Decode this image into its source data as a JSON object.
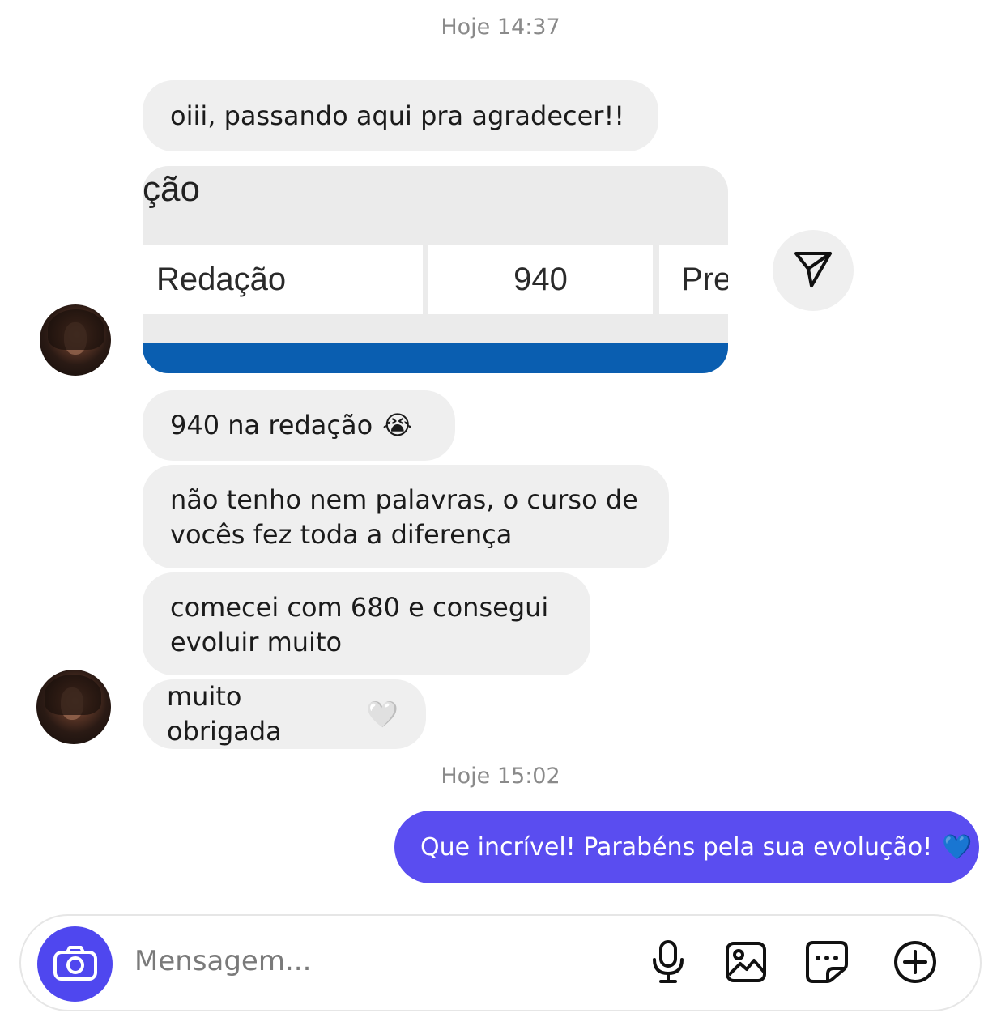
{
  "timestamps": [
    "Hoje 14:37",
    "Hoje 15:02"
  ],
  "received_messages": [
    "oiii, passando aqui pra agradecer!!",
    "940 na redação",
    "não tenho nem palavras, o curso de",
    "vocês fez toda a diferença",
    "comecei com 680 e consegui",
    "evoluir muito",
    "muito obrigada"
  ],
  "emojis": {
    "crying": "😭",
    "white_heart": "🤍",
    "blue_heart": "💙"
  },
  "screenshot_card": {
    "title_fragment": "ção",
    "cells": [
      "Redação",
      "940",
      "Pre"
    ],
    "bar_color": "#0a5eb0"
  },
  "sent_message": "Que incrível! Parabéns pela sua evolução!",
  "composer": {
    "placeholder": "Mensagem..."
  },
  "icons": [
    "send-icon",
    "camera-icon",
    "microphone-icon",
    "image-icon",
    "sticker-icon",
    "plus-icon"
  ],
  "colors": {
    "accent": "#5a4df0",
    "bubble": "#efefef",
    "timestamp": "#8a8a8a"
  }
}
